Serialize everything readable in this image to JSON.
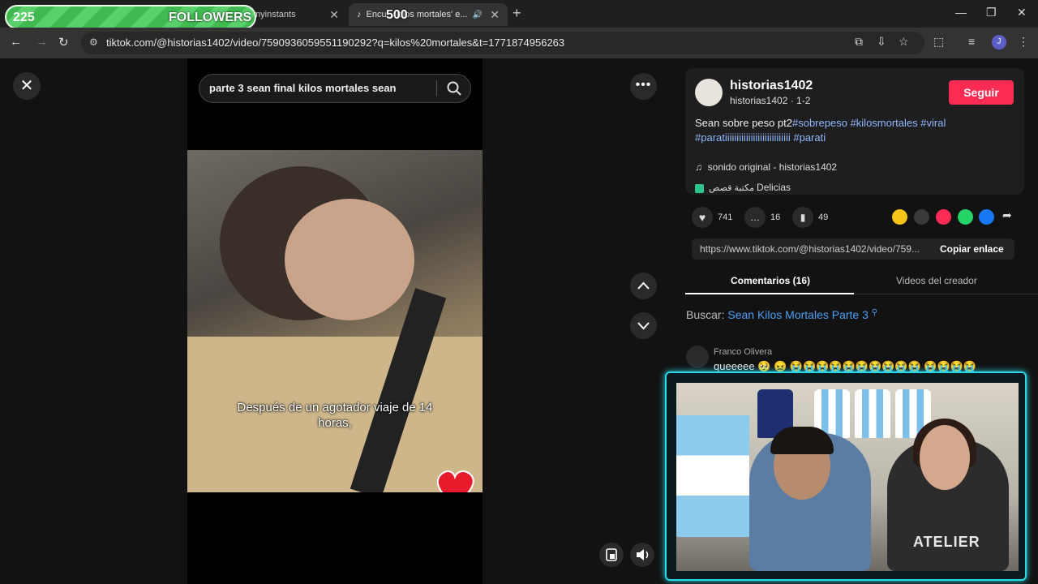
{
  "browser": {
    "tabs": [
      {
        "title": "myinstants",
        "active": false
      },
      {
        "title": "Encu... kilos mortales' e...",
        "active": true
      }
    ],
    "new_tab": "+",
    "url": "tiktok.com/@historias1402/video/7590936059551190292?q=kilos%20mortales&t=1771874956263",
    "profile_letter": "J",
    "window_buttons": [
      "—",
      "❐",
      "✕"
    ]
  },
  "stream_overlay": {
    "count": "225",
    "label": "FOLLOWERS",
    "goal": "500"
  },
  "player": {
    "search_query": "parte 3 sean final kilos mortales sean",
    "subtitle": "Después de un agotador viaje de 14 horas,",
    "close_symbol": "✕",
    "more_symbol": "•••"
  },
  "author": {
    "username": "historias1402",
    "subline": "historias1402 · 1-2",
    "follow_label": "Seguir"
  },
  "description": {
    "text": "Sean sobre peso pt2",
    "hashtags": [
      "#sobrepeso",
      "#kilosmortales",
      "#viral",
      "#paratiiiiiiiiiiiiiiiiiiiiiiiiiiii",
      "#parati"
    ]
  },
  "sound": "sonido original - historias1402",
  "playlist": {
    "arabic": "مكتبة قصص",
    "name": "Delicias"
  },
  "stats": {
    "likes": "741",
    "comments": "16",
    "saves": "49"
  },
  "share_colors": [
    "#f5c518",
    "#3a3a3a",
    "#fe2c55",
    "#25d366",
    "#1877f2"
  ],
  "copy_link": {
    "url": "https://www.tiktok.com/@historias1402/video/759...",
    "button": "Copiar enlace"
  },
  "tabs": {
    "comments": "Comentarios (16)",
    "creator": "Videos del creador"
  },
  "search_suggest": {
    "label": "Buscar:",
    "value": "Sean Kilos Mortales Parte 3"
  },
  "comment": {
    "author": "Franco Olivera",
    "text": "queeeee 🥺 😖 😭😭😭😭😭😭😭😭😭😭 😭😭😭😭"
  },
  "webcam": {
    "shirt_text": "ATELIER"
  }
}
